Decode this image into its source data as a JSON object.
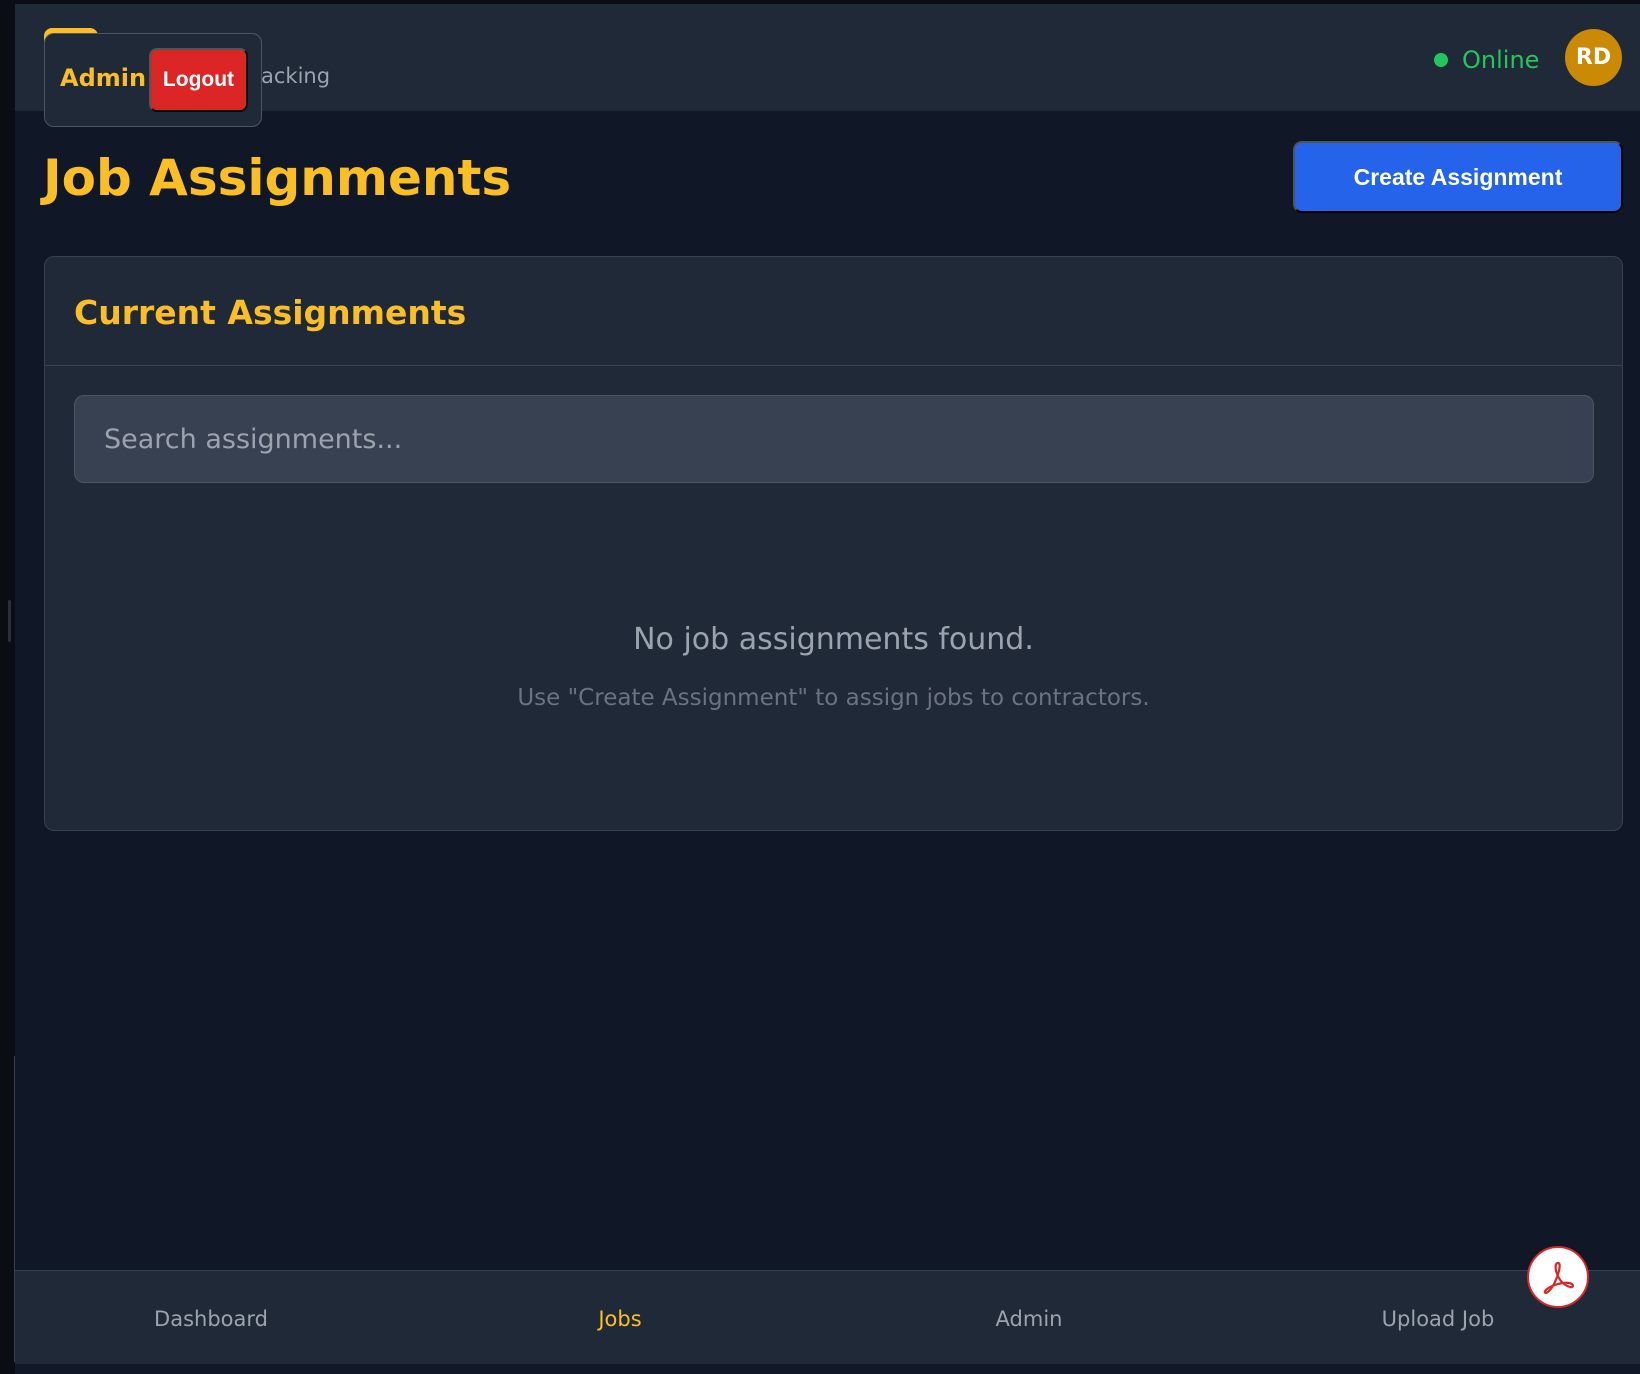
{
  "header": {
    "subtitle_fragment": "acking",
    "admin_popover": {
      "label": "Admin",
      "logout_label": "Logout"
    },
    "status": {
      "label": "Online",
      "color": "#22c55e"
    },
    "avatar_initials": "RD"
  },
  "page": {
    "title": "Job Assignments",
    "create_button_label": "Create Assignment"
  },
  "card": {
    "title": "Current Assignments",
    "search": {
      "placeholder": "Search assignments...",
      "value": ""
    },
    "empty_state": {
      "message": "No job assignments found.",
      "hint": "Use \"Create Assignment\" to assign jobs to contractors."
    }
  },
  "bottom_nav": {
    "items": [
      {
        "label": "Dashboard",
        "active": false
      },
      {
        "label": "Jobs",
        "active": true
      },
      {
        "label": "Admin",
        "active": false
      },
      {
        "label": "Upload Job",
        "active": false
      }
    ]
  },
  "fab": {
    "icon": "pdf-icon"
  },
  "colors": {
    "accent": "#fbbf24",
    "primary": "#2563eb",
    "danger": "#dc2626",
    "background": "#111827",
    "surface": "#1f2937"
  }
}
